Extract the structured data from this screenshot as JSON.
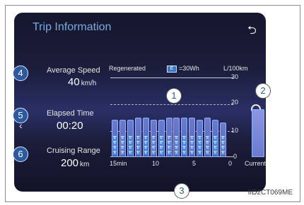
{
  "screen": {
    "title": "Trip Information",
    "back_icon": "return-arrow-icon"
  },
  "left_panel": {
    "average_speed": {
      "label": "Average Speed",
      "value": "40",
      "unit": "km/h",
      "callout": "4"
    },
    "elapsed_time": {
      "label": "Elapsed Time",
      "value": "00:20",
      "callout": "5"
    },
    "cruising_range": {
      "label": "Cruising Range",
      "value": "200",
      "unit": "km",
      "callout": "6"
    }
  },
  "chart_header": {
    "regenerated": "Regenerated",
    "legend_symbol": "E",
    "legend_value": "=30Wh",
    "consumption_unit": "L/100km"
  },
  "callouts": {
    "bars": "1",
    "current": "2",
    "regen": "3"
  },
  "chart_data": {
    "type": "bar",
    "ylim": [
      0,
      30
    ],
    "y_ticks": [
      "30",
      "20",
      "10",
      "0"
    ],
    "x_ticks": [
      "15min",
      "10",
      "5",
      "0",
      "Current"
    ],
    "series": [
      {
        "values": [
          14,
          14,
          14,
          15,
          15,
          14,
          14,
          15,
          15,
          15,
          15,
          14,
          15,
          14,
          13
        ]
      }
    ],
    "regen_segments": [
      4,
      4,
      4,
      4,
      4,
      4,
      4,
      4,
      4,
      4,
      4,
      4,
      4,
      4,
      4
    ],
    "current_value": 18
  },
  "image_code": "IID2CT069ME",
  "colors": {
    "bar": "#5b6fd0",
    "regen": "#4b8de3",
    "title": "#7aa9e0"
  }
}
